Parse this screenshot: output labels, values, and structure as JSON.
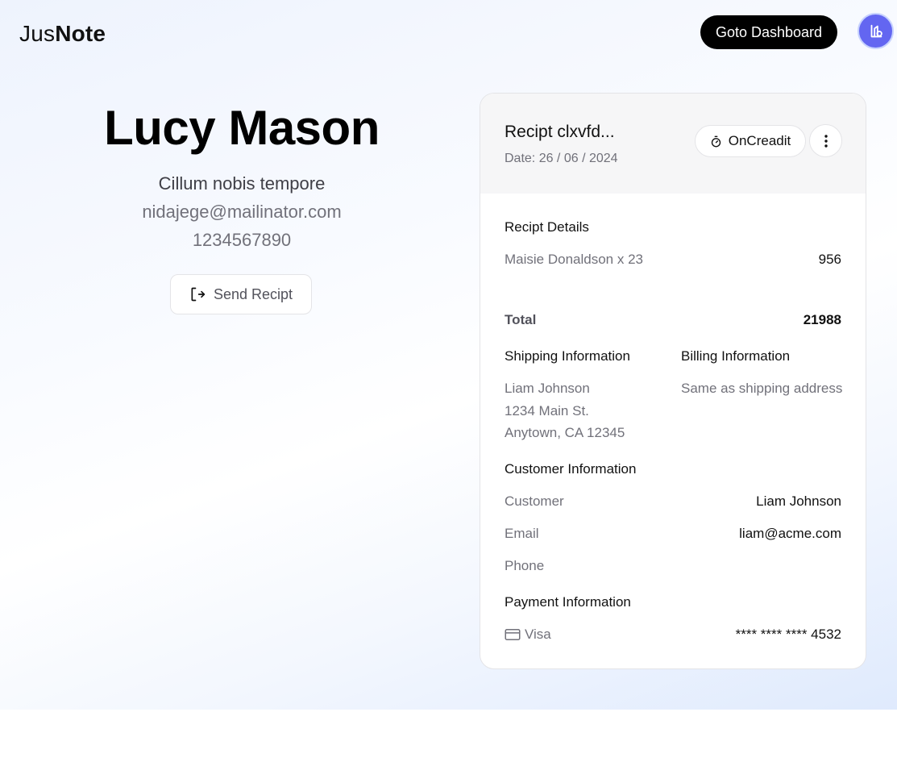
{
  "header": {
    "logo_light": "Jus",
    "logo_bold": "Note",
    "goto_label": "Goto Dashboard"
  },
  "profile": {
    "name": "Lucy Mason",
    "subtitle": "Cillum nobis tempore",
    "email": "nidajege@mailinator.com",
    "phone": "1234567890",
    "send_label": "Send Recipt"
  },
  "receipt": {
    "title": "Recipt clxvfd...",
    "date": "Date: 26 / 06 / 2024",
    "status_label": "OnCreadit",
    "details_title": "Recipt Details",
    "items": [
      {
        "label": "Maisie Donaldson x 23",
        "amount": "956"
      }
    ],
    "total_label": "Total",
    "total_value": "21988",
    "shipping": {
      "title": "Shipping Information",
      "lines": [
        "Liam Johnson",
        "1234 Main St.",
        "Anytown, CA 12345"
      ]
    },
    "billing": {
      "title": "Billing Information",
      "text": "Same as shipping address"
    },
    "customer": {
      "title": "Customer Information",
      "customer_label": "Customer",
      "customer_value": "Liam Johnson",
      "email_label": "Email",
      "email_value": "liam@acme.com",
      "phone_label": "Phone",
      "phone_value": ""
    },
    "payment": {
      "title": "Payment Information",
      "method": "Visa",
      "card": "**** **** **** 4532"
    }
  },
  "colors": {
    "accent": "#6366f1",
    "primary_button": "#000000"
  }
}
